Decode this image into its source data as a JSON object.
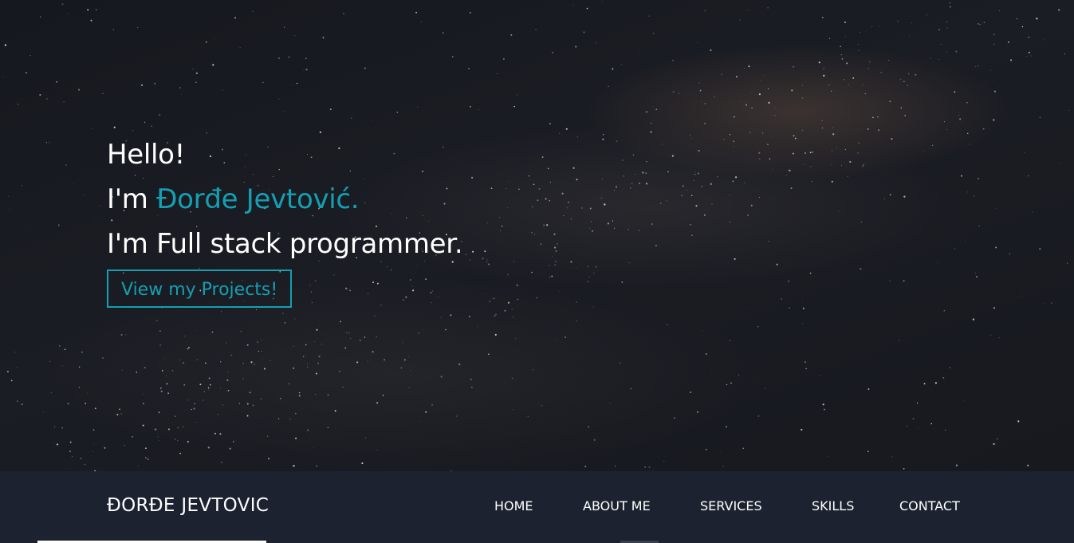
{
  "hero": {
    "greeting": "Hello!",
    "intro_prefix": "I'm ",
    "name": "Đorđe Jevtović.",
    "tagline": "I'm Full stack programmer.",
    "cta_label": "View my Projects!"
  },
  "navbar": {
    "brand": "ĐORĐE JEVTOVIC",
    "items": [
      {
        "label": "HOME"
      },
      {
        "label": "ABOUT ME"
      },
      {
        "label": "SERVICES"
      },
      {
        "label": "SKILLS"
      },
      {
        "label": "CONTACT"
      }
    ]
  },
  "colors": {
    "accent": "#159fb3",
    "navbar_bg": "#1c2230",
    "hero_bg": "#16181f",
    "text": "#ffffff"
  }
}
